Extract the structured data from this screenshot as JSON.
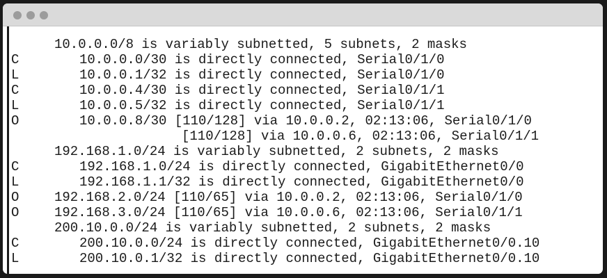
{
  "window": {
    "controls": [
      "close",
      "minimize",
      "maximize"
    ]
  },
  "routes": [
    {
      "code": "",
      "text": "10.0.0.0/8 is variably subnetted, 5 subnets, 2 masks",
      "indent": 1
    },
    {
      "code": "C",
      "text": "10.0.0.0/30 is directly connected, Serial0/1/0",
      "indent": 2
    },
    {
      "code": "L",
      "text": "10.0.0.1/32 is directly connected, Serial0/1/0",
      "indent": 2
    },
    {
      "code": "C",
      "text": "10.0.0.4/30 is directly connected, Serial0/1/1",
      "indent": 2
    },
    {
      "code": "L",
      "text": "10.0.0.5/32 is directly connected, Serial0/1/1",
      "indent": 2
    },
    {
      "code": "O",
      "text": "10.0.0.8/30 [110/128] via 10.0.0.2, 02:13:06, Serial0/1/0",
      "indent": 2
    },
    {
      "code": "",
      "text": "[110/128] via 10.0.0.6, 02:13:06, Serial0/1/1",
      "indent": 3
    },
    {
      "code": "",
      "text": "192.168.1.0/24 is variably subnetted, 2 subnets, 2 masks",
      "indent": 1
    },
    {
      "code": "C",
      "text": "192.168.1.0/24 is directly connected, GigabitEthernet0/0",
      "indent": 2
    },
    {
      "code": "L",
      "text": "192.168.1.1/32 is directly connected, GigabitEthernet0/0",
      "indent": 2
    },
    {
      "code": "O",
      "text": "192.168.2.0/24 [110/65] via 10.0.0.2, 02:13:06, Serial0/1/0",
      "indent": 1
    },
    {
      "code": "O",
      "text": "192.168.3.0/24 [110/65] via 10.0.0.6, 02:13:06, Serial0/1/1",
      "indent": 1
    },
    {
      "code": "",
      "text": "200.10.0.0/24 is variably subnetted, 2 subnets, 2 masks",
      "indent": 1
    },
    {
      "code": "C",
      "text": "200.10.0.0/24 is directly connected, GigabitEthernet0/0.10",
      "indent": 2
    },
    {
      "code": "L",
      "text": "200.10.0.1/32 is directly connected, GigabitEthernet0/0.10",
      "indent": 2
    }
  ]
}
